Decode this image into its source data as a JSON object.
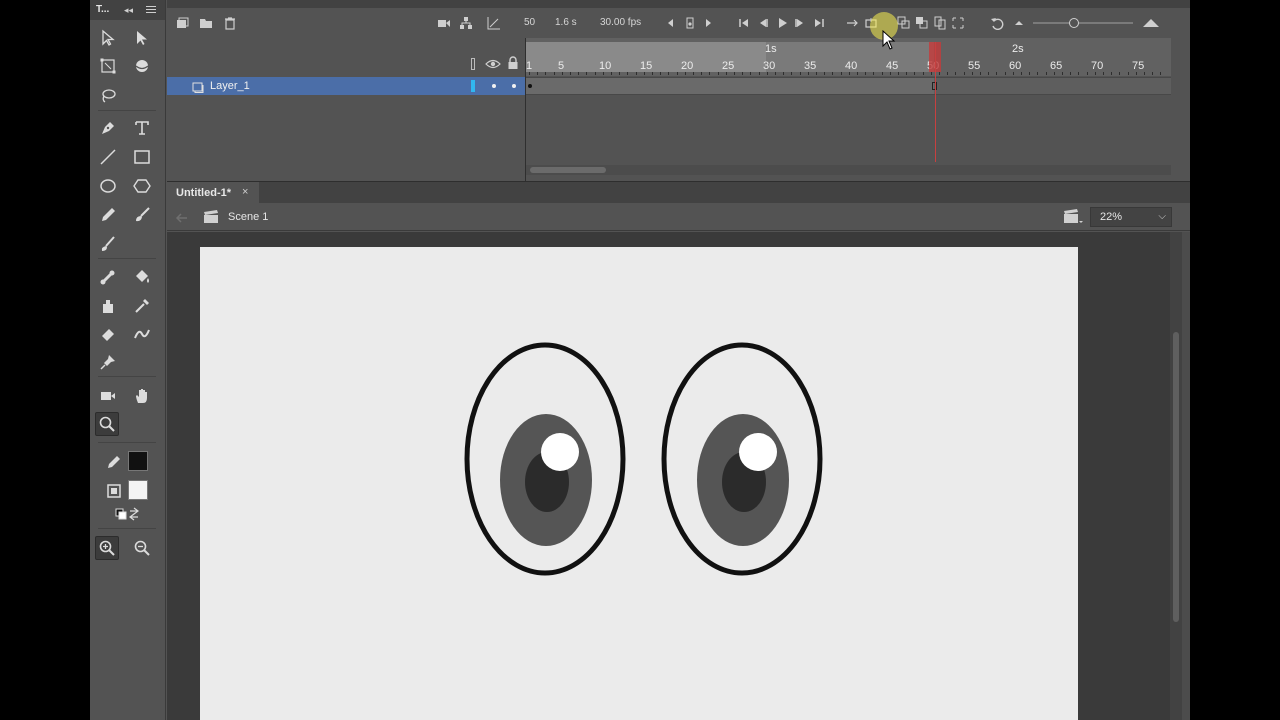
{
  "tools_panel": {
    "title": "T...",
    "fill_color": "#111111",
    "stroke_color": "#f4f4f4"
  },
  "timeline": {
    "current_frame": "50",
    "time": "1.6 s",
    "fps": "30.00 fps",
    "ruler_seconds": [
      "1s",
      "2s"
    ],
    "ruler_ticks": [
      "1",
      "5",
      "10",
      "15",
      "20",
      "25",
      "30",
      "35",
      "40",
      "45",
      "50",
      "55",
      "60",
      "65",
      "70",
      "75"
    ],
    "layers": [
      {
        "name": "Layer_1",
        "color": "#31b7f0"
      }
    ]
  },
  "document": {
    "tab_title": "Untitled-1*",
    "close": "×",
    "scene": "Scene 1",
    "zoom": "22%"
  },
  "stage": {
    "eyes": [
      {
        "outline": "#111111",
        "iris": "#555555",
        "pupil": "#2b2b2b",
        "highlight": "#ffffff"
      },
      {
        "outline": "#111111",
        "iris": "#555555",
        "pupil": "#2b2b2b",
        "highlight": "#ffffff"
      }
    ]
  }
}
